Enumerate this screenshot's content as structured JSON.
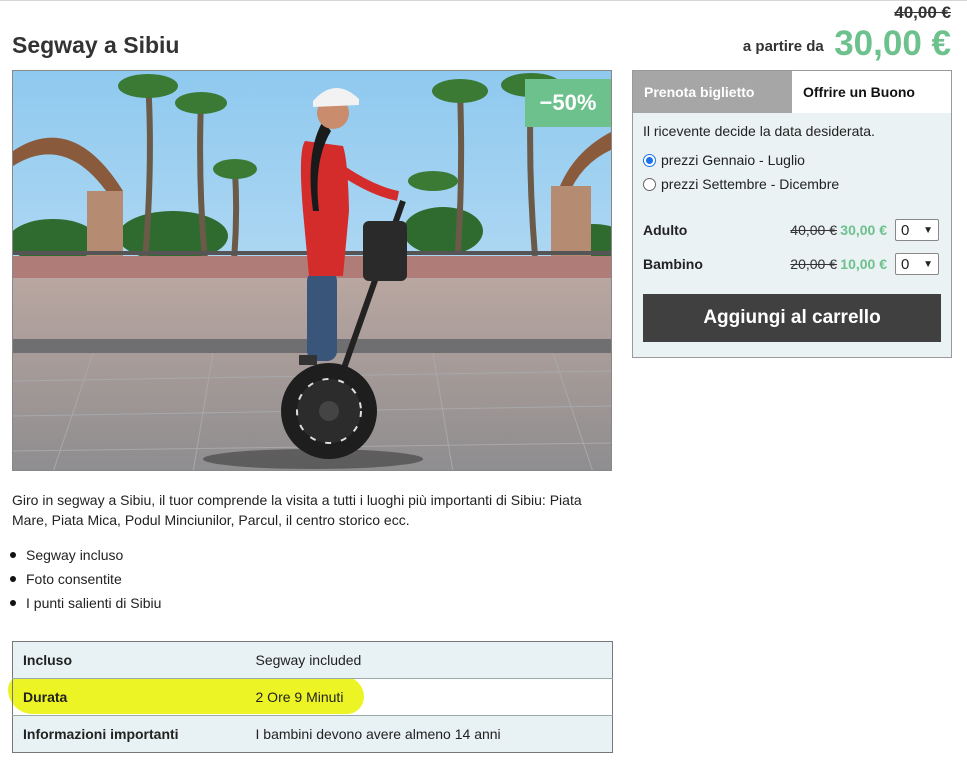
{
  "header": {
    "title": "Segway a Sibiu",
    "old_price": "40,00 €",
    "from_label": "a partire da",
    "price": "30,00 €"
  },
  "hero": {
    "discount": "−50%"
  },
  "description": "Giro in segway a Sibiu, il tuor comprende la visita a tutti i luoghi più importanti di Sibiu: Piata Mare, Piata Mica, Podul Minciunilor, Parcul, il centro storico ecc.",
  "features": [
    "Segway incluso",
    "Foto consentite",
    "I punti salienti di Sibiu"
  ],
  "info": [
    {
      "key": "Incluso",
      "value": "Segway included"
    },
    {
      "key": "Durata",
      "value": "2 Ore 9 Minuti"
    },
    {
      "key": "Informazioni importanti",
      "value": "I bambini devono avere almeno 14 anni"
    }
  ],
  "booking": {
    "tabs": [
      "Prenota biglietto",
      "Offrire un Buono"
    ],
    "receiver_text": "Il ricevente decide la data desiderata.",
    "periods": [
      {
        "label": "prezzi Gennaio - Luglio",
        "selected": true
      },
      {
        "label": "prezzi Settembre - Dicembre",
        "selected": false
      }
    ],
    "tickets": [
      {
        "label": "Adulto",
        "old": "40,00 €",
        "new": "30,00 €",
        "qty": "0"
      },
      {
        "label": "Bambino",
        "old": "20,00 €",
        "new": "10,00 €",
        "qty": "0"
      }
    ],
    "cart_button": "Aggiungi al carrello"
  },
  "colors": {
    "accent_green": "#6cc18c",
    "dark_button": "#404040",
    "panel_bg": "#eaf2f4",
    "highlight": "#eaf200"
  }
}
